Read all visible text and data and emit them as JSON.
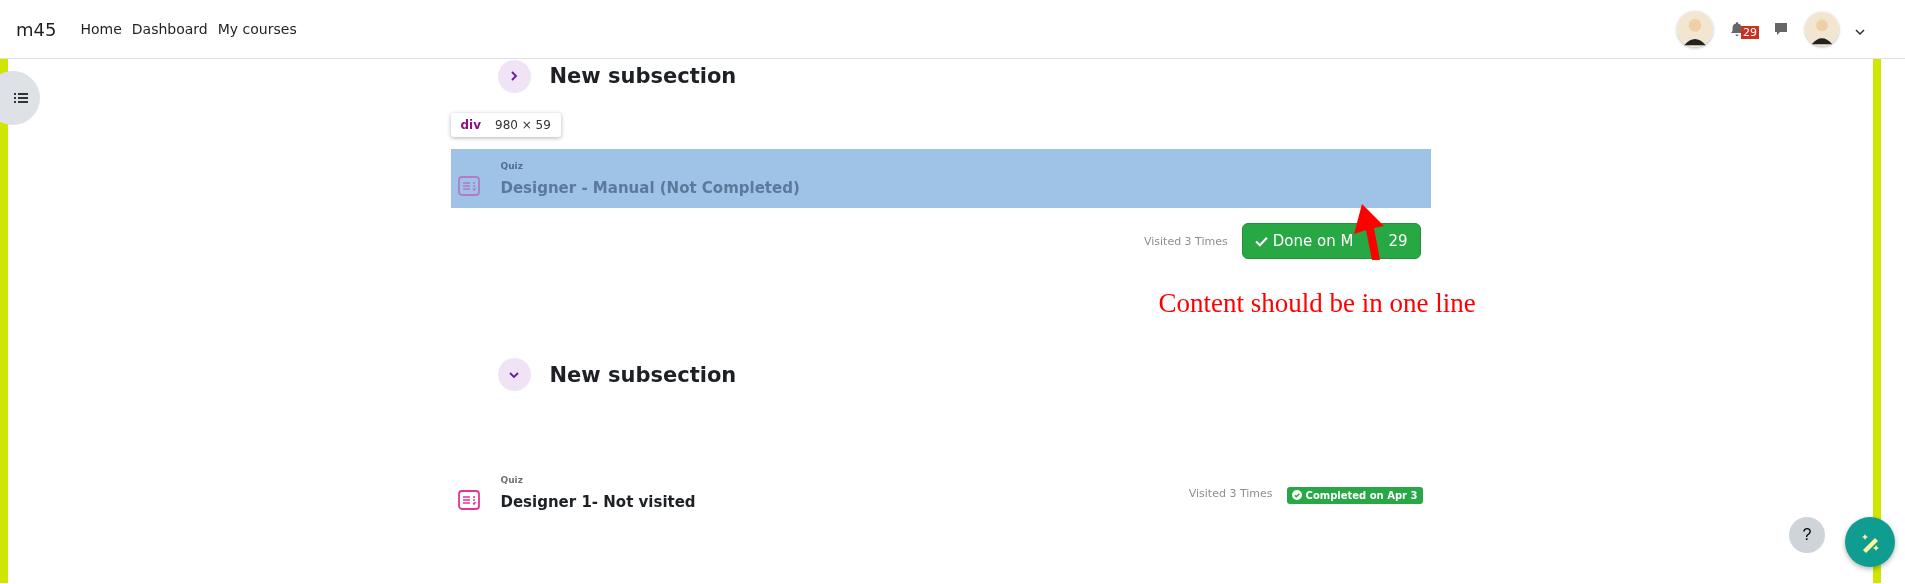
{
  "navbar": {
    "brand": "m45",
    "links": [
      "Home",
      "Dashboard",
      "My courses"
    ],
    "notification_count": "29"
  },
  "sections": [
    {
      "title": "New subsection",
      "expanded": false,
      "activity": {
        "type": "Quiz",
        "title": "Designer - Manual (Not Completed)",
        "highlighted": true,
        "inspector_tooltip": {
          "tag": "div",
          "size": "980 × 59"
        },
        "visits": "Visited 3 Times",
        "completion": {
          "kind": "button",
          "label_parts": [
            "Done on M",
            "29"
          ]
        }
      }
    },
    {
      "title": "New subsection",
      "expanded": true,
      "activity": {
        "type": "Quiz",
        "title": "Designer 1- Not visited",
        "highlighted": false,
        "visits": "Visited 3 Times",
        "completion": {
          "kind": "badge",
          "label_parts": [
            "Completed on Apr 3"
          ]
        }
      }
    }
  ],
  "annotation": {
    "text": "Content should be in one line"
  },
  "help_button": "?"
}
